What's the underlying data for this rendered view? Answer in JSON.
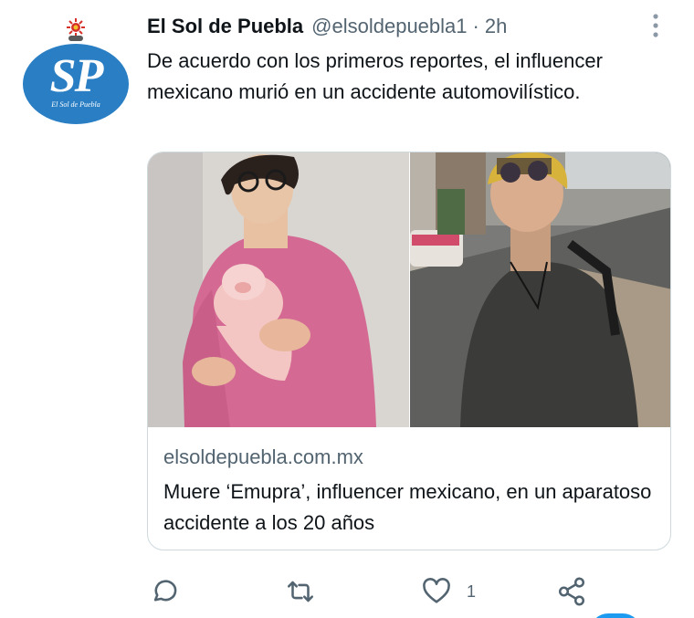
{
  "tweet": {
    "author_name": "El Sol de Puebla",
    "handle": "@elsoldepuebla1",
    "separator": "·",
    "time": "2h",
    "text": "De acuerdo con los primeros reportes, el influencer mexicano murió en un accidente automovilístico.",
    "avatar_logo": "SP",
    "avatar_logo_sub": "El Sol de Puebla"
  },
  "card": {
    "domain": "elsoldepuebla.com.mx",
    "title": "Muere ‘Emupra’, influencer mexicano, en un aparatoso accidente a los 20 años",
    "left_image": "photo-young-man-pink-shirt-holding-plush-pig",
    "right_image": "photo-young-man-street-sunglasses-yellow-cap"
  },
  "actions": {
    "reply_icon": "reply-icon",
    "retweet_icon": "retweet-icon",
    "like_icon": "heart-icon",
    "like_count": "1",
    "share_icon": "share-icon"
  },
  "colors": {
    "accent": "#1d9bf0",
    "secondary_text": "#536471",
    "border": "#cfd9de",
    "avatar_blue": "#2a7fc4"
  }
}
